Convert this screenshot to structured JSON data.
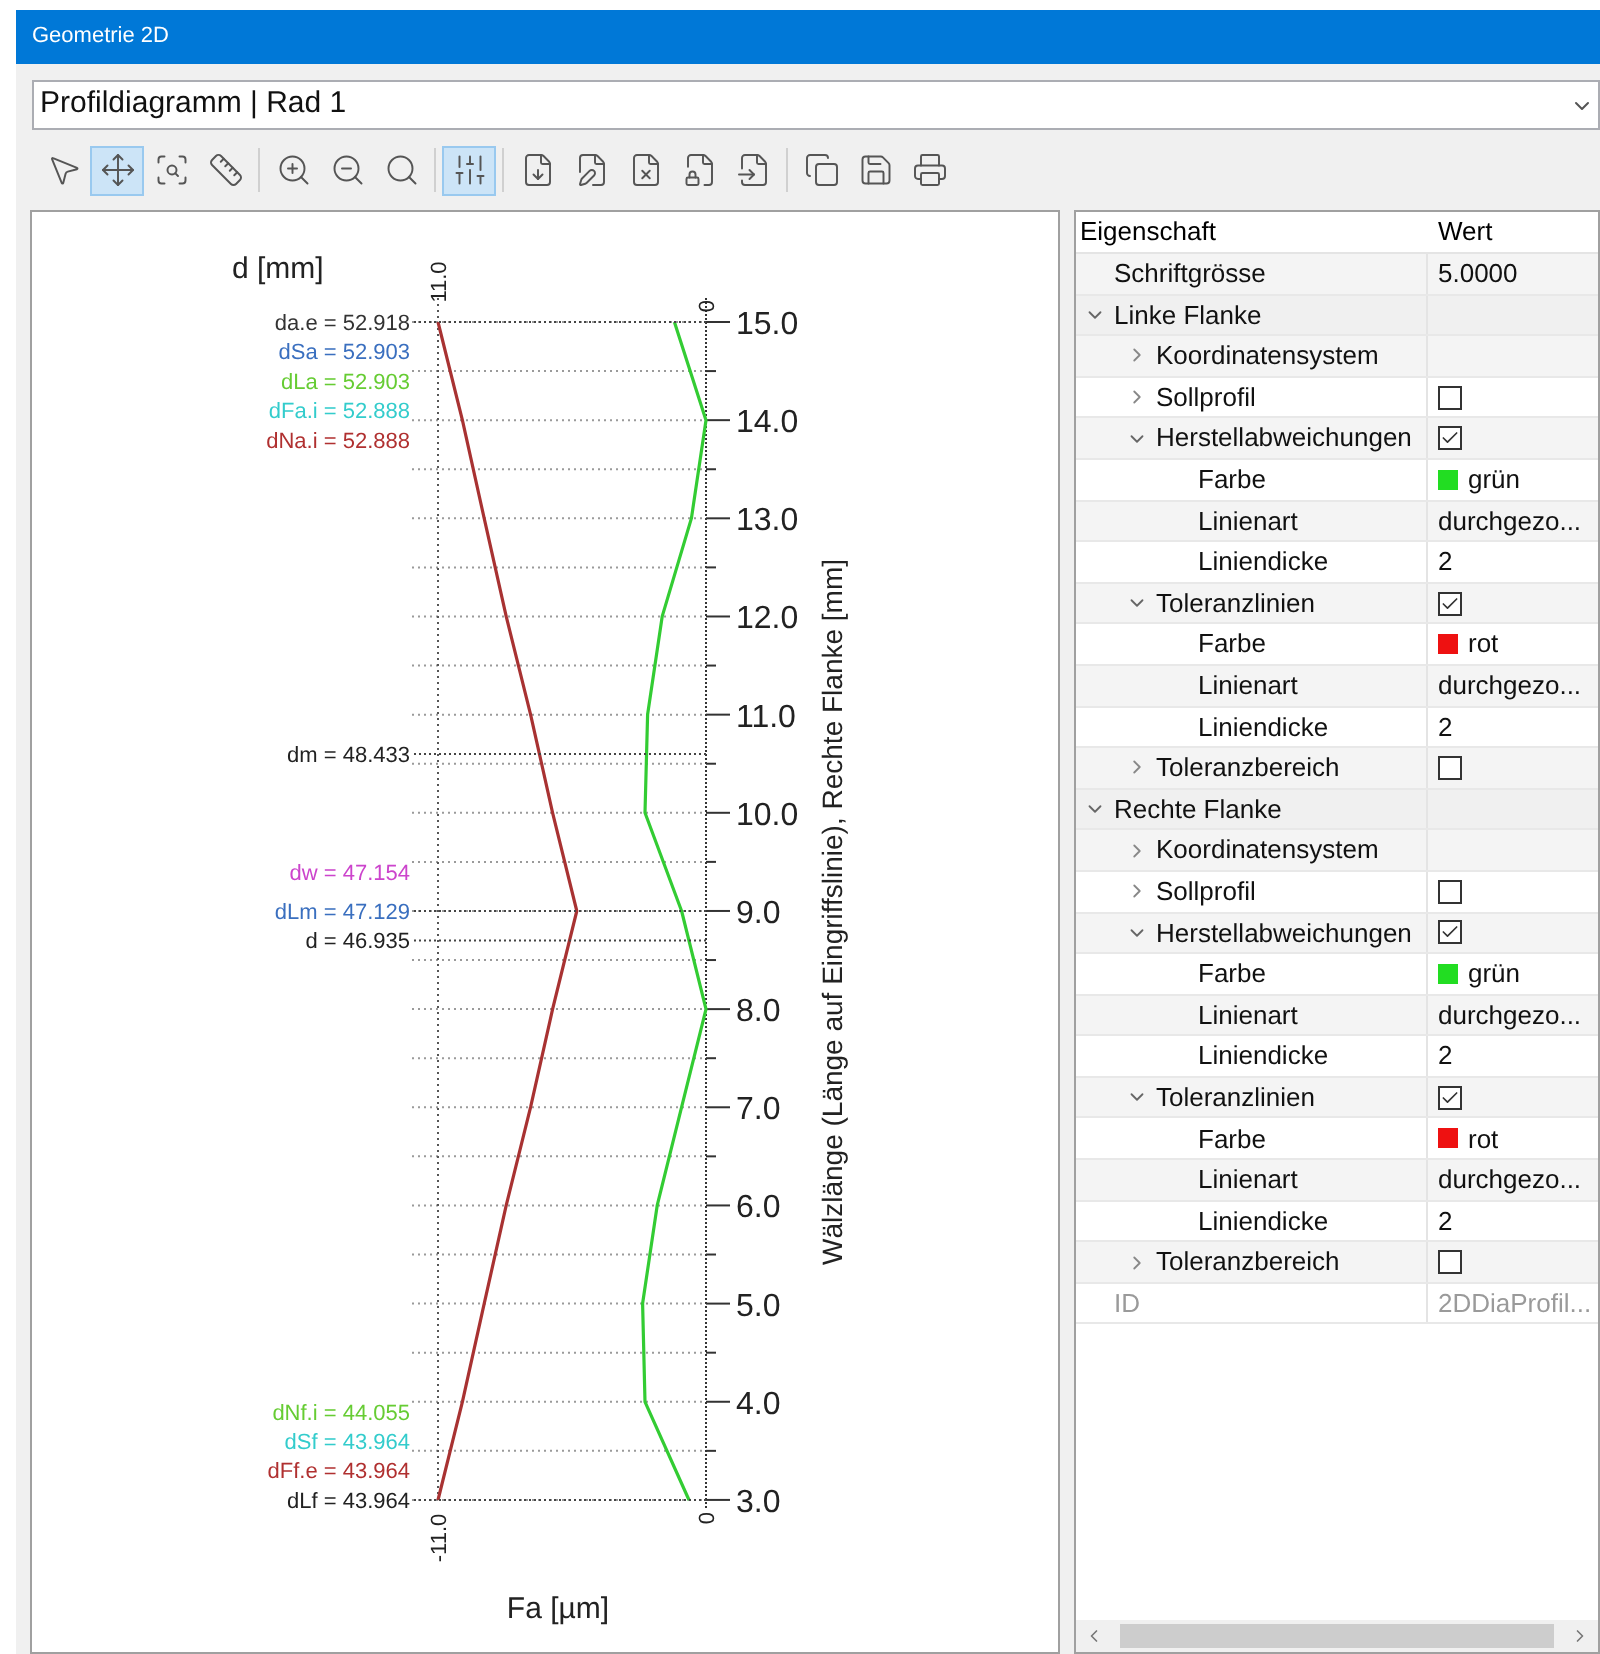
{
  "window": {
    "title": "Geometrie 2D"
  },
  "diagram_selector": {
    "value": "Profildiagramm | Rad 1"
  },
  "toolbar": [
    [
      {
        "kind": "pointer",
        "selected": false
      },
      {
        "kind": "move",
        "selected": true
      },
      {
        "kind": "zoom_box",
        "selected": false
      },
      {
        "kind": "ruler",
        "selected": false
      }
    ],
    [
      {
        "kind": "zoom_in",
        "selected": false
      },
      {
        "kind": "zoom_out",
        "selected": false
      },
      {
        "kind": "zoom_fit",
        "selected": false
      }
    ],
    [
      {
        "kind": "sliders",
        "selected": true
      }
    ],
    [
      {
        "kind": "file_save",
        "selected": false
      },
      {
        "kind": "file_pin",
        "selected": false
      },
      {
        "kind": "file_delete",
        "selected": false
      },
      {
        "kind": "file_lock",
        "selected": false
      },
      {
        "kind": "file_import",
        "selected": false
      }
    ],
    [
      {
        "kind": "copy",
        "selected": false
      },
      {
        "kind": "save",
        "selected": false
      },
      {
        "kind": "print",
        "selected": false
      }
    ]
  ],
  "diagram": {
    "top_axis_labels": [
      "11.0",
      "0"
    ],
    "diameter_labels": [
      {
        "text": "da.e = 52.918",
        "color": "#333333",
        "leader": true
      },
      {
        "text": "dSa = 52.903",
        "color": "#3a6fbf",
        "leader": false
      },
      {
        "text": "dLa = 52.903",
        "color": "#66cc33",
        "leader": false
      },
      {
        "text": "dFa.i = 52.888",
        "color": "#33cccc",
        "leader": false
      },
      {
        "text": "dNa.i = 52.888",
        "color": "#b03030",
        "leader": false
      },
      {
        "text": "dm = 48.433",
        "color": "#222222",
        "leader": true
      },
      {
        "text": "dw = 47.154",
        "color": "#cc44cc",
        "leader": false
      },
      {
        "text": "dLm = 47.129",
        "color": "#3a6fbf",
        "leader": true
      },
      {
        "text": "d = 46.935",
        "color": "#222222",
        "leader": true
      },
      {
        "text": "dNf.i = 44.055",
        "color": "#66cc33",
        "leader": false
      },
      {
        "text": "dSf = 43.964",
        "color": "#33cccc",
        "leader": false
      },
      {
        "text": "dFf.e = 43.964",
        "color": "#b03030",
        "leader": false
      },
      {
        "text": "dLf = 43.964",
        "color": "#222222",
        "leader": true
      }
    ],
    "chart_data": {
      "type": "line",
      "orientation": "horizontal",
      "grid": true,
      "title": "d [mm]",
      "xlabel": "Fa [µm]",
      "ylabel": "Wälzlänge (Länge auf Eingriffslinie), Rechte Flanke [mm]",
      "x": [
        3,
        4,
        5,
        6,
        7,
        8,
        9,
        10,
        11,
        12,
        13,
        14,
        15
      ],
      "xlim": [
        -11,
        0
      ],
      "ylim": [
        3,
        15
      ],
      "xticks": [
        {
          "value": -11,
          "label": "-11.0"
        },
        {
          "value": 0,
          "label": "0"
        }
      ],
      "yticks": [
        {
          "value": 15,
          "label": "15.0"
        },
        {
          "value": 14,
          "label": "14.0"
        },
        {
          "value": 13,
          "label": "13.0"
        },
        {
          "value": 12,
          "label": "12.0"
        },
        {
          "value": 11,
          "label": "11.0"
        },
        {
          "value": 10,
          "label": "10.0"
        },
        {
          "value": 9,
          "label": "9.0"
        },
        {
          "value": 8,
          "label": "8.0"
        },
        {
          "value": 7,
          "label": "7.0"
        },
        {
          "value": 6,
          "label": "6.0"
        },
        {
          "value": 5,
          "label": "5.0"
        },
        {
          "value": 4,
          "label": "4.0"
        },
        {
          "value": 3,
          "label": "3.0"
        }
      ],
      "series": [
        {
          "color": "#a83232",
          "values": [
            -11,
            -10,
            -9.1,
            -8.2,
            -7.2,
            -6.3,
            -5.3,
            -6.3,
            -7.2,
            -8.2,
            -9.1,
            -10,
            -11
          ]
        },
        {
          "color": "#33cc33",
          "values": [
            -0.7,
            -2.5,
            -2.6,
            -2.0,
            -1.0,
            0,
            -1.0,
            -2.5,
            -2.4,
            -1.8,
            -0.6,
            0,
            -1.3
          ]
        }
      ]
    }
  },
  "properties": {
    "columns": [
      "Eigenschaft",
      "Wert"
    ],
    "rows": [
      {
        "label": "Schriftgrösse",
        "kind": "text",
        "value": "5.0000"
      },
      {
        "label": "Linke Flanke",
        "kind": "category",
        "expanded": true,
        "children": [
          {
            "label": "Koordinatensystem",
            "kind": "none",
            "expanded": false
          },
          {
            "label": "Sollprofil",
            "kind": "checkbox",
            "checked": false,
            "expanded": false
          },
          {
            "label": "Herstellabweichungen",
            "kind": "checkbox",
            "checked": true,
            "expanded": true,
            "children": [
              {
                "label": "Farbe",
                "kind": "color",
                "value": "grün",
                "color": "#22dd22"
              },
              {
                "label": "Linienart",
                "kind": "text",
                "value": "durchgezo..."
              },
              {
                "label": "Liniendicke",
                "kind": "text",
                "value": "2"
              }
            ]
          },
          {
            "label": "Toleranzlinien",
            "kind": "checkbox",
            "checked": true,
            "expanded": true,
            "children": [
              {
                "label": "Farbe",
                "kind": "color",
                "value": "rot",
                "color": "#ee1111"
              },
              {
                "label": "Linienart",
                "kind": "text",
                "value": "durchgezo..."
              },
              {
                "label": "Liniendicke",
                "kind": "text",
                "value": "2"
              }
            ]
          },
          {
            "label": "Toleranzbereich",
            "kind": "checkbox",
            "checked": false,
            "expanded": false
          }
        ]
      },
      {
        "label": "Rechte Flanke",
        "kind": "category",
        "expanded": true,
        "children": [
          {
            "label": "Koordinatensystem",
            "kind": "none",
            "expanded": false
          },
          {
            "label": "Sollprofil",
            "kind": "checkbox",
            "checked": false,
            "expanded": false
          },
          {
            "label": "Herstellabweichungen",
            "kind": "checkbox",
            "checked": true,
            "expanded": true,
            "children": [
              {
                "label": "Farbe",
                "kind": "color",
                "value": "grün",
                "color": "#22dd22"
              },
              {
                "label": "Linienart",
                "kind": "text",
                "value": "durchgezo..."
              },
              {
                "label": "Liniendicke",
                "kind": "text",
                "value": "2"
              }
            ]
          },
          {
            "label": "Toleranzlinien",
            "kind": "checkbox",
            "checked": true,
            "expanded": true,
            "children": [
              {
                "label": "Farbe",
                "kind": "color",
                "value": "rot",
                "color": "#ee1111"
              },
              {
                "label": "Linienart",
                "kind": "text",
                "value": "durchgezo..."
              },
              {
                "label": "Liniendicke",
                "kind": "text",
                "value": "2"
              }
            ]
          },
          {
            "label": "Toleranzbereich",
            "kind": "checkbox",
            "checked": false,
            "expanded": false
          }
        ]
      },
      {
        "label": "ID",
        "kind": "text",
        "value": "2DDiaProfil...",
        "disabled": true
      }
    ]
  }
}
